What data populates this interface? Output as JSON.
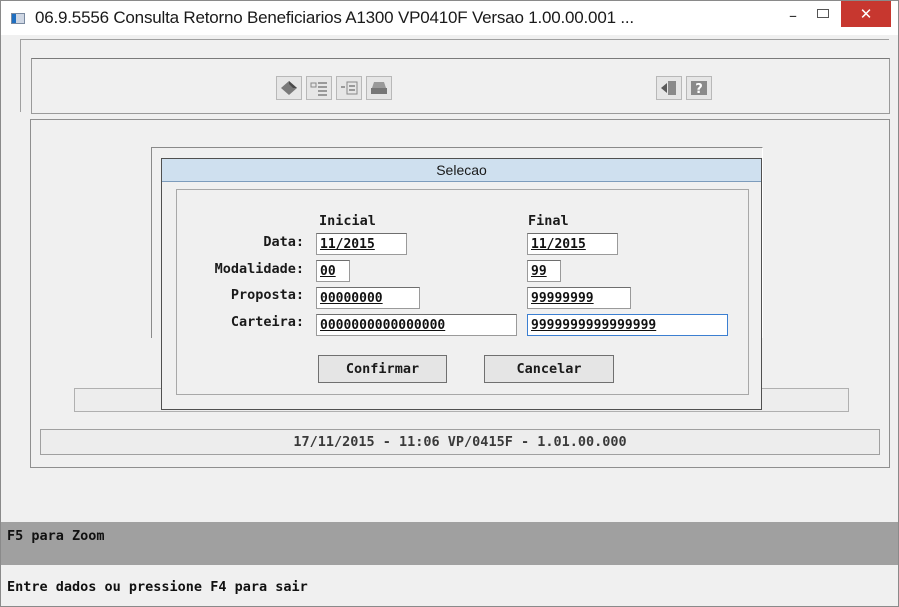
{
  "window": {
    "title": "06.9.5556 Consulta Retorno Beneficiarios A1300 VP0410F Versao 1.00.00.001 ...",
    "minimize_glyph": "–",
    "close_glyph": "✕"
  },
  "toolbar": {
    "icons": [
      "edit-icon",
      "list-icon",
      "align-icon",
      "print-icon",
      "exit-icon",
      "help-icon"
    ]
  },
  "dialog": {
    "title": "Selecao",
    "headers": {
      "inicial": "Inicial",
      "final": "Final"
    },
    "rows": [
      {
        "label": "Data:",
        "inicial": "11/2015",
        "final": "11/2015"
      },
      {
        "label": "Modalidade:",
        "inicial": "00",
        "final": "99"
      },
      {
        "label": "Proposta:",
        "inicial": "00000000",
        "final": "99999999"
      },
      {
        "label": "Carteira:",
        "inicial": "0000000000000000",
        "final": "9999999999999999"
      }
    ],
    "confirm_label": "Confirmar",
    "cancel_label": "Cancelar"
  },
  "status": {
    "text": "17/11/2015 - 11:06  VP/0415F - 1.01.00.000"
  },
  "footer": {
    "hint": "F5 para Zoom",
    "message": "Entre dados ou pressione F4 para sair"
  }
}
